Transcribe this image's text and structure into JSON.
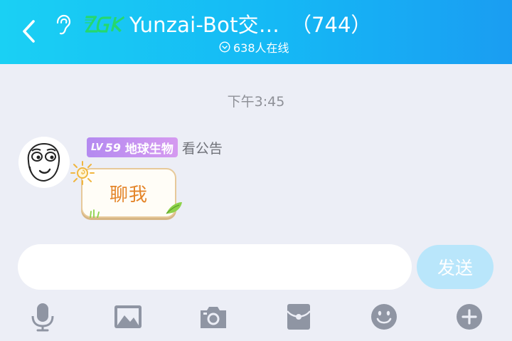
{
  "header": {
    "title": "Yunzai-Bot交…",
    "member_count": "（744）",
    "online": "638人在线"
  },
  "chat": {
    "timestamp": "下午3:45",
    "messages": [
      {
        "level_prefix": "LV",
        "level_number": "59",
        "level_title": "地球生物",
        "note": "看公告",
        "text": "聊我"
      }
    ]
  },
  "composer": {
    "placeholder": "",
    "send_label": "发送"
  },
  "toolbar": {
    "items": [
      "microphone-icon",
      "image-icon",
      "camera-icon",
      "red-packet-icon",
      "emoji-icon",
      "plus-icon"
    ]
  },
  "colors": {
    "header_gradient_start": "#1ad0f4",
    "header_gradient_end": "#1a9df2",
    "background": "#eceef6",
    "send_button": "#b9e6fb",
    "toolbar_icon": "#8f95a3",
    "bubble_text": "#e4852a",
    "level_badge": "#c694f0"
  }
}
